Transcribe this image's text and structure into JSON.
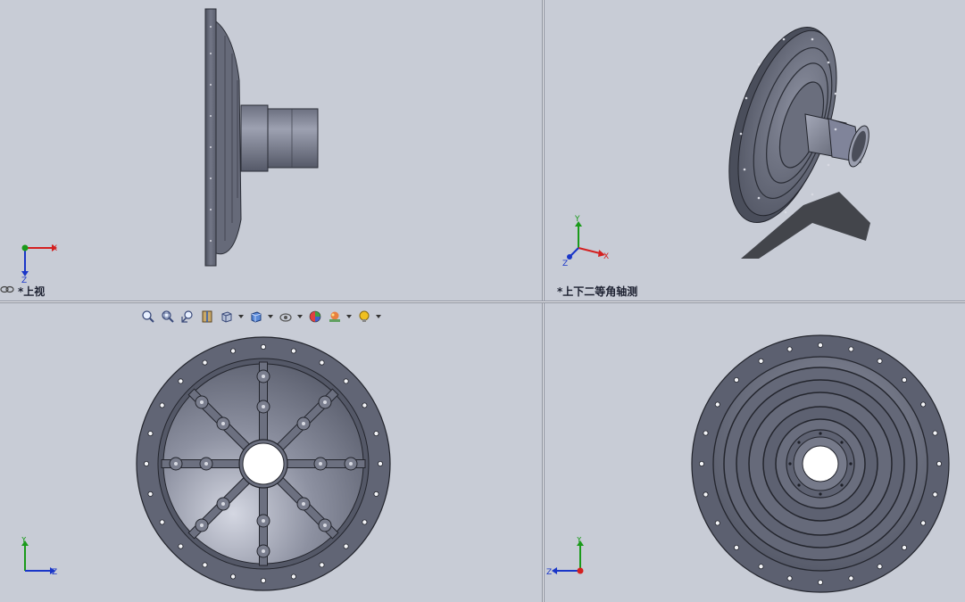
{
  "viewports": {
    "top_left": {
      "label": "*上视",
      "triad": {
        "horizontal": "X",
        "vertical": "Z"
      }
    },
    "top_right": {
      "label": "*上下二等角轴测",
      "triad": {
        "vertical": "Y",
        "horizontal": "X",
        "depth": "Z"
      }
    },
    "bottom_left": {
      "triad": {
        "vertical": "Y",
        "horizontal": "Z"
      }
    },
    "bottom_right": {
      "triad": {
        "vertical": "Y",
        "horizontal": "Z"
      }
    }
  },
  "toolbar": {
    "items": [
      {
        "icon": "zoom-to-fit-icon"
      },
      {
        "icon": "zoom-to-area-icon"
      },
      {
        "icon": "previous-view-icon"
      },
      {
        "icon": "section-view-icon"
      },
      {
        "icon": "view-orientation-icon",
        "dropdown": true
      },
      {
        "icon": "display-style-icon",
        "dropdown": true
      },
      {
        "icon": "hide-show-items-icon",
        "dropdown": true
      },
      {
        "icon": "edit-appearance-icon"
      },
      {
        "icon": "apply-scene-icon",
        "dropdown": true
      },
      {
        "icon": "view-settings-icon",
        "dropdown": true
      }
    ]
  },
  "colors": {
    "background": "#c8ccd6",
    "part": "#5f6373",
    "part_light": "#8a8e9e",
    "axis_x": "#d42020",
    "axis_y": "#1a9a1a",
    "axis_z": "#1a36c8"
  }
}
